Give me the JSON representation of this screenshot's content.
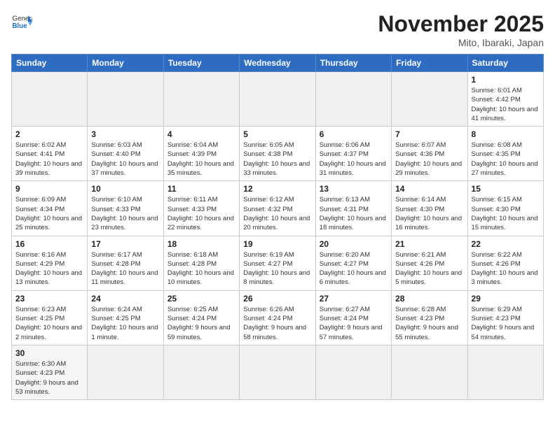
{
  "header": {
    "logo_general": "General",
    "logo_blue": "Blue",
    "month_title": "November 2025",
    "location": "Mito, Ibaraki, Japan"
  },
  "days_of_week": [
    "Sunday",
    "Monday",
    "Tuesday",
    "Wednesday",
    "Thursday",
    "Friday",
    "Saturday"
  ],
  "weeks": [
    [
      {
        "day": "",
        "info": ""
      },
      {
        "day": "",
        "info": ""
      },
      {
        "day": "",
        "info": ""
      },
      {
        "day": "",
        "info": ""
      },
      {
        "day": "",
        "info": ""
      },
      {
        "day": "",
        "info": ""
      },
      {
        "day": "1",
        "info": "Sunrise: 6:01 AM\nSunset: 4:42 PM\nDaylight: 10 hours and 41 minutes."
      }
    ],
    [
      {
        "day": "2",
        "info": "Sunrise: 6:02 AM\nSunset: 4:41 PM\nDaylight: 10 hours and 39 minutes."
      },
      {
        "day": "3",
        "info": "Sunrise: 6:03 AM\nSunset: 4:40 PM\nDaylight: 10 hours and 37 minutes."
      },
      {
        "day": "4",
        "info": "Sunrise: 6:04 AM\nSunset: 4:39 PM\nDaylight: 10 hours and 35 minutes."
      },
      {
        "day": "5",
        "info": "Sunrise: 6:05 AM\nSunset: 4:38 PM\nDaylight: 10 hours and 33 minutes."
      },
      {
        "day": "6",
        "info": "Sunrise: 6:06 AM\nSunset: 4:37 PM\nDaylight: 10 hours and 31 minutes."
      },
      {
        "day": "7",
        "info": "Sunrise: 6:07 AM\nSunset: 4:36 PM\nDaylight: 10 hours and 29 minutes."
      },
      {
        "day": "8",
        "info": "Sunrise: 6:08 AM\nSunset: 4:35 PM\nDaylight: 10 hours and 27 minutes."
      }
    ],
    [
      {
        "day": "9",
        "info": "Sunrise: 6:09 AM\nSunset: 4:34 PM\nDaylight: 10 hours and 25 minutes."
      },
      {
        "day": "10",
        "info": "Sunrise: 6:10 AM\nSunset: 4:33 PM\nDaylight: 10 hours and 23 minutes."
      },
      {
        "day": "11",
        "info": "Sunrise: 6:11 AM\nSunset: 4:33 PM\nDaylight: 10 hours and 22 minutes."
      },
      {
        "day": "12",
        "info": "Sunrise: 6:12 AM\nSunset: 4:32 PM\nDaylight: 10 hours and 20 minutes."
      },
      {
        "day": "13",
        "info": "Sunrise: 6:13 AM\nSunset: 4:31 PM\nDaylight: 10 hours and 18 minutes."
      },
      {
        "day": "14",
        "info": "Sunrise: 6:14 AM\nSunset: 4:30 PM\nDaylight: 10 hours and 16 minutes."
      },
      {
        "day": "15",
        "info": "Sunrise: 6:15 AM\nSunset: 4:30 PM\nDaylight: 10 hours and 15 minutes."
      }
    ],
    [
      {
        "day": "16",
        "info": "Sunrise: 6:16 AM\nSunset: 4:29 PM\nDaylight: 10 hours and 13 minutes."
      },
      {
        "day": "17",
        "info": "Sunrise: 6:17 AM\nSunset: 4:28 PM\nDaylight: 10 hours and 11 minutes."
      },
      {
        "day": "18",
        "info": "Sunrise: 6:18 AM\nSunset: 4:28 PM\nDaylight: 10 hours and 10 minutes."
      },
      {
        "day": "19",
        "info": "Sunrise: 6:19 AM\nSunset: 4:27 PM\nDaylight: 10 hours and 8 minutes."
      },
      {
        "day": "20",
        "info": "Sunrise: 6:20 AM\nSunset: 4:27 PM\nDaylight: 10 hours and 6 minutes."
      },
      {
        "day": "21",
        "info": "Sunrise: 6:21 AM\nSunset: 4:26 PM\nDaylight: 10 hours and 5 minutes."
      },
      {
        "day": "22",
        "info": "Sunrise: 6:22 AM\nSunset: 4:26 PM\nDaylight: 10 hours and 3 minutes."
      }
    ],
    [
      {
        "day": "23",
        "info": "Sunrise: 6:23 AM\nSunset: 4:25 PM\nDaylight: 10 hours and 2 minutes."
      },
      {
        "day": "24",
        "info": "Sunrise: 6:24 AM\nSunset: 4:25 PM\nDaylight: 10 hours and 1 minute."
      },
      {
        "day": "25",
        "info": "Sunrise: 6:25 AM\nSunset: 4:24 PM\nDaylight: 9 hours and 59 minutes."
      },
      {
        "day": "26",
        "info": "Sunrise: 6:26 AM\nSunset: 4:24 PM\nDaylight: 9 hours and 58 minutes."
      },
      {
        "day": "27",
        "info": "Sunrise: 6:27 AM\nSunset: 4:24 PM\nDaylight: 9 hours and 57 minutes."
      },
      {
        "day": "28",
        "info": "Sunrise: 6:28 AM\nSunset: 4:23 PM\nDaylight: 9 hours and 55 minutes."
      },
      {
        "day": "29",
        "info": "Sunrise: 6:29 AM\nSunset: 4:23 PM\nDaylight: 9 hours and 54 minutes."
      }
    ],
    [
      {
        "day": "30",
        "info": "Sunrise: 6:30 AM\nSunset: 4:23 PM\nDaylight: 9 hours and 53 minutes."
      },
      {
        "day": "",
        "info": ""
      },
      {
        "day": "",
        "info": ""
      },
      {
        "day": "",
        "info": ""
      },
      {
        "day": "",
        "info": ""
      },
      {
        "day": "",
        "info": ""
      },
      {
        "day": "",
        "info": ""
      }
    ]
  ]
}
